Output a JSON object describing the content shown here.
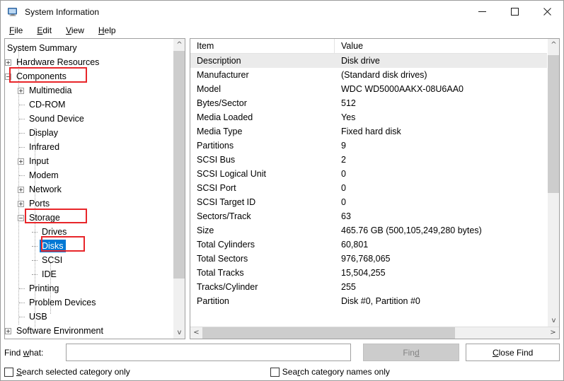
{
  "window": {
    "title": "System Information",
    "icon": "computer-icon",
    "controls": {
      "minimize": "minimize-icon",
      "maximize": "maximize-icon",
      "close": "close-icon"
    }
  },
  "menubar": {
    "items": [
      {
        "label": "File",
        "accel": "F"
      },
      {
        "label": "Edit",
        "accel": "E"
      },
      {
        "label": "View",
        "accel": "V"
      },
      {
        "label": "Help",
        "accel": "H"
      }
    ]
  },
  "tree": {
    "nodes": [
      {
        "label": "System Summary",
        "indent": 0,
        "marker": "none",
        "selected": false,
        "highlight": false
      },
      {
        "label": "Hardware Resources",
        "indent": 1,
        "marker": "plus",
        "selected": false,
        "highlight": false
      },
      {
        "label": "Components",
        "indent": 1,
        "marker": "minus",
        "selected": false,
        "highlight": true
      },
      {
        "label": "Multimedia",
        "indent": 2,
        "marker": "plus",
        "selected": false,
        "highlight": false
      },
      {
        "label": "CD-ROM",
        "indent": 2,
        "marker": "leaf",
        "selected": false,
        "highlight": false
      },
      {
        "label": "Sound Device",
        "indent": 2,
        "marker": "leaf",
        "selected": false,
        "highlight": false
      },
      {
        "label": "Display",
        "indent": 2,
        "marker": "leaf",
        "selected": false,
        "highlight": false
      },
      {
        "label": "Infrared",
        "indent": 2,
        "marker": "leaf",
        "selected": false,
        "highlight": false
      },
      {
        "label": "Input",
        "indent": 2,
        "marker": "plus",
        "selected": false,
        "highlight": false
      },
      {
        "label": "Modem",
        "indent": 2,
        "marker": "leaf",
        "selected": false,
        "highlight": false
      },
      {
        "label": "Network",
        "indent": 2,
        "marker": "plus",
        "selected": false,
        "highlight": false
      },
      {
        "label": "Ports",
        "indent": 2,
        "marker": "plus",
        "selected": false,
        "highlight": false
      },
      {
        "label": "Storage",
        "indent": 2,
        "marker": "minus",
        "selected": false,
        "highlight": true
      },
      {
        "label": "Drives",
        "indent": 3,
        "marker": "leaf",
        "selected": false,
        "highlight": false
      },
      {
        "label": "Disks",
        "indent": 3,
        "marker": "leaf",
        "selected": true,
        "highlight": true
      },
      {
        "label": "SCSI",
        "indent": 3,
        "marker": "leaf",
        "selected": false,
        "highlight": false
      },
      {
        "label": "IDE",
        "indent": 3,
        "marker": "leaf",
        "selected": false,
        "highlight": false
      },
      {
        "label": "Printing",
        "indent": 2,
        "marker": "leaf",
        "selected": false,
        "highlight": false
      },
      {
        "label": "Problem Devices",
        "indent": 2,
        "marker": "leaf",
        "selected": false,
        "highlight": false
      },
      {
        "label": "USB",
        "indent": 2,
        "marker": "leaf",
        "selected": false,
        "highlight": false
      },
      {
        "label": "Software Environment",
        "indent": 1,
        "marker": "plus",
        "selected": false,
        "highlight": false
      }
    ]
  },
  "list": {
    "columns": [
      "Item",
      "Value"
    ],
    "rows": [
      {
        "item": "Description",
        "value": "Disk drive",
        "selected": true
      },
      {
        "item": "Manufacturer",
        "value": "(Standard disk drives)",
        "selected": false
      },
      {
        "item": "Model",
        "value": "WDC WD5000AAKX-08U6AA0",
        "selected": false
      },
      {
        "item": "Bytes/Sector",
        "value": "512",
        "selected": false
      },
      {
        "item": "Media Loaded",
        "value": "Yes",
        "selected": false
      },
      {
        "item": "Media Type",
        "value": "Fixed hard disk",
        "selected": false
      },
      {
        "item": "Partitions",
        "value": "9",
        "selected": false
      },
      {
        "item": "SCSI Bus",
        "value": "2",
        "selected": false
      },
      {
        "item": "SCSI Logical Unit",
        "value": "0",
        "selected": false
      },
      {
        "item": "SCSI Port",
        "value": "0",
        "selected": false
      },
      {
        "item": "SCSI Target ID",
        "value": "0",
        "selected": false
      },
      {
        "item": "Sectors/Track",
        "value": "63",
        "selected": false
      },
      {
        "item": "Size",
        "value": "465.76 GB (500,105,249,280 bytes)",
        "selected": false
      },
      {
        "item": "Total Cylinders",
        "value": "60,801",
        "selected": false
      },
      {
        "item": "Total Sectors",
        "value": "976,768,065",
        "selected": false
      },
      {
        "item": "Total Tracks",
        "value": "15,504,255",
        "selected": false
      },
      {
        "item": "Tracks/Cylinder",
        "value": "255",
        "selected": false
      },
      {
        "item": "Partition",
        "value": "Disk #0, Partition #0",
        "selected": false
      }
    ]
  },
  "find": {
    "label_prefix": "Find ",
    "label_accel": "w",
    "label_suffix": "hat:",
    "input_value": "",
    "input_placeholder": "",
    "find_button": {
      "prefix": "Fin",
      "accel": "d",
      "suffix": "",
      "disabled": true
    },
    "close_button": {
      "prefix": "",
      "accel": "C",
      "suffix": "lose Find"
    },
    "checkbox1": {
      "prefix": "",
      "accel": "S",
      "suffix": "earch selected category only",
      "checked": false
    },
    "checkbox2": {
      "prefix": "Sea",
      "accel": "r",
      "suffix": "ch category names only",
      "checked": false
    }
  },
  "colors": {
    "selection_blue": "#0078d4",
    "annotation_red": "#e8262a",
    "row_selected_gray": "#ebebeb",
    "scrollbar_thumb": "#cdcdcd"
  }
}
